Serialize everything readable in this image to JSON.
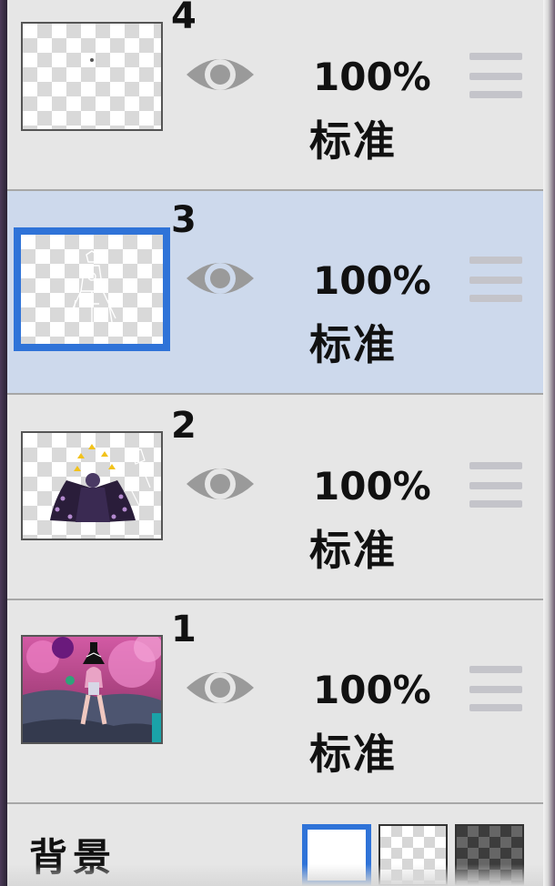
{
  "layers": [
    {
      "number": "4",
      "opacity": "100%",
      "blend_mode": "标准",
      "visible": true,
      "selected": false,
      "thumbnail": "mostly-transparent"
    },
    {
      "number": "3",
      "opacity": "100%",
      "blend_mode": "标准",
      "visible": true,
      "selected": true,
      "thumbnail": "white-line-sketch"
    },
    {
      "number": "2",
      "opacity": "100%",
      "blend_mode": "标准",
      "visible": true,
      "selected": false,
      "thumbnail": "dark-purple-figure"
    },
    {
      "number": "1",
      "opacity": "100%",
      "blend_mode": "标准",
      "visible": true,
      "selected": false,
      "thumbnail": "pink-scene-photo"
    }
  ],
  "background": {
    "label": "背景",
    "options": [
      "white",
      "transparent",
      "dark"
    ],
    "selected": "white"
  },
  "icons": {
    "visibility": "eye-icon",
    "reorder": "drag-handle-icon"
  },
  "colors": {
    "selection_bg": "#cdd9ec",
    "selection_border": "#2f73d8",
    "panel_bg": "#e6e6e6",
    "eye": "#9a9a9a"
  }
}
